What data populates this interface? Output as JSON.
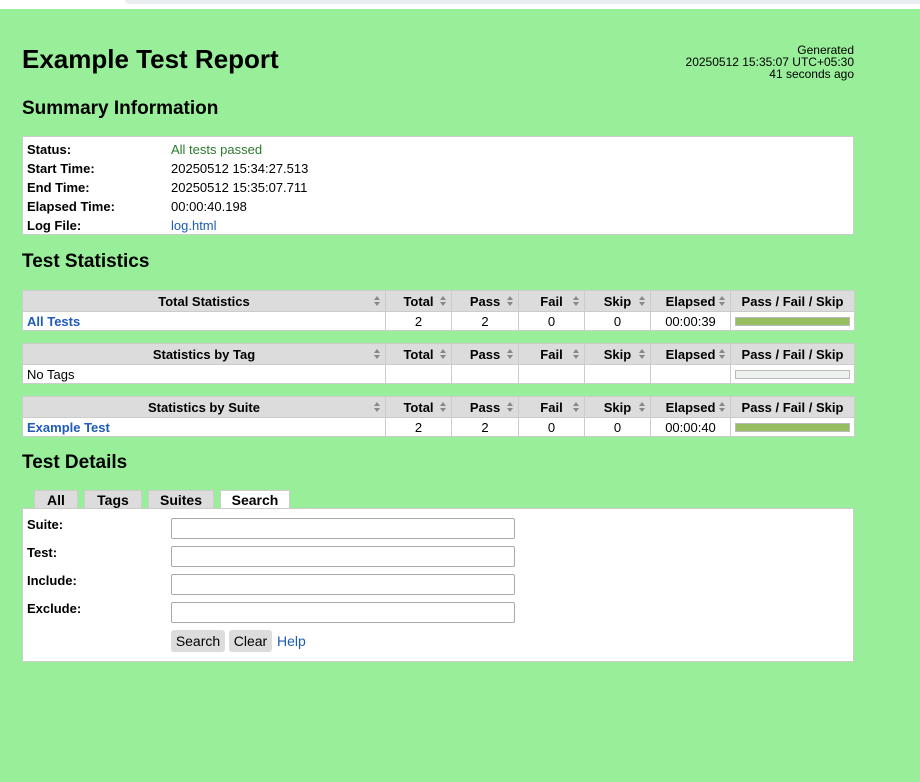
{
  "header": {
    "title": "Example Test Report",
    "generated_label": "Generated",
    "generated_time": "20250512 15:35:07 UTC+05:30",
    "generated_ago": "41 seconds ago"
  },
  "summary": {
    "heading": "Summary Information",
    "rows": [
      {
        "label": "Status:",
        "value": "All tests passed"
      },
      {
        "label": "Start Time:",
        "value": "20250512 15:34:27.513"
      },
      {
        "label": "End Time:",
        "value": "20250512 15:35:07.711"
      },
      {
        "label": "Elapsed Time:",
        "value": "00:00:40.198"
      },
      {
        "label": "Log File:",
        "value": "log.html"
      }
    ]
  },
  "statistics": {
    "heading": "Test Statistics",
    "columns": [
      "Total",
      "Pass",
      "Fail",
      "Skip",
      "Elapsed",
      "Pass / Fail / Skip"
    ],
    "tables": [
      {
        "title": "Total Statistics",
        "row": {
          "name": "All Tests",
          "total": "2",
          "pass": "2",
          "fail": "0",
          "skip": "0",
          "elapsed": "00:00:39",
          "pass_fraction": 1.0
        }
      },
      {
        "title": "Statistics by Tag",
        "row": {
          "name": "No Tags",
          "total": "",
          "pass": "",
          "fail": "",
          "skip": "",
          "elapsed": "",
          "pass_fraction": 0
        }
      },
      {
        "title": "Statistics by Suite",
        "row": {
          "name": "Example Test",
          "total": "2",
          "pass": "2",
          "fail": "0",
          "skip": "0",
          "elapsed": "00:00:40",
          "pass_fraction": 1.0
        }
      }
    ]
  },
  "details": {
    "heading": "Test Details",
    "tabs": [
      "All",
      "Tags",
      "Suites",
      "Search"
    ],
    "active_tab": "Search",
    "fields": [
      {
        "label": "Suite:",
        "value": ""
      },
      {
        "label": "Test:",
        "value": ""
      },
      {
        "label": "Include:",
        "value": ""
      },
      {
        "label": "Exclude:",
        "value": ""
      }
    ],
    "search_button": "Search",
    "clear_button": "Clear",
    "help_link": "Help"
  },
  "colors": {
    "background": "#99ee99",
    "pass_bar": "#97bd61",
    "link": "#1d5bb8",
    "pass_text": "#2c7a2c"
  }
}
